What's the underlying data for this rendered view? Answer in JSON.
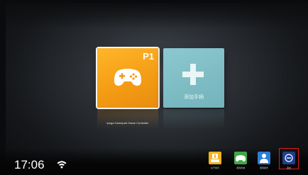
{
  "home": {
    "card_game": {
      "badge": "P1",
      "caption": "Ipega Gamepad Game Controller"
    },
    "card_add": {
      "label": "添加手柄"
    }
  },
  "status": {
    "time": "17:06"
  },
  "dock": {
    "items": [
      {
        "label": "关于我们",
        "icon": "download-box-icon"
      },
      {
        "label": "游戏商城",
        "icon": "gamepad-icon"
      },
      {
        "label": "游戏模式",
        "icon": "person-icon"
      },
      {
        "label": "退出",
        "icon": "exit-icon"
      }
    ]
  },
  "colors": {
    "game_card": "#f39b14",
    "add_card": "#73b3bb",
    "exit_highlight": "#e01b1b"
  }
}
